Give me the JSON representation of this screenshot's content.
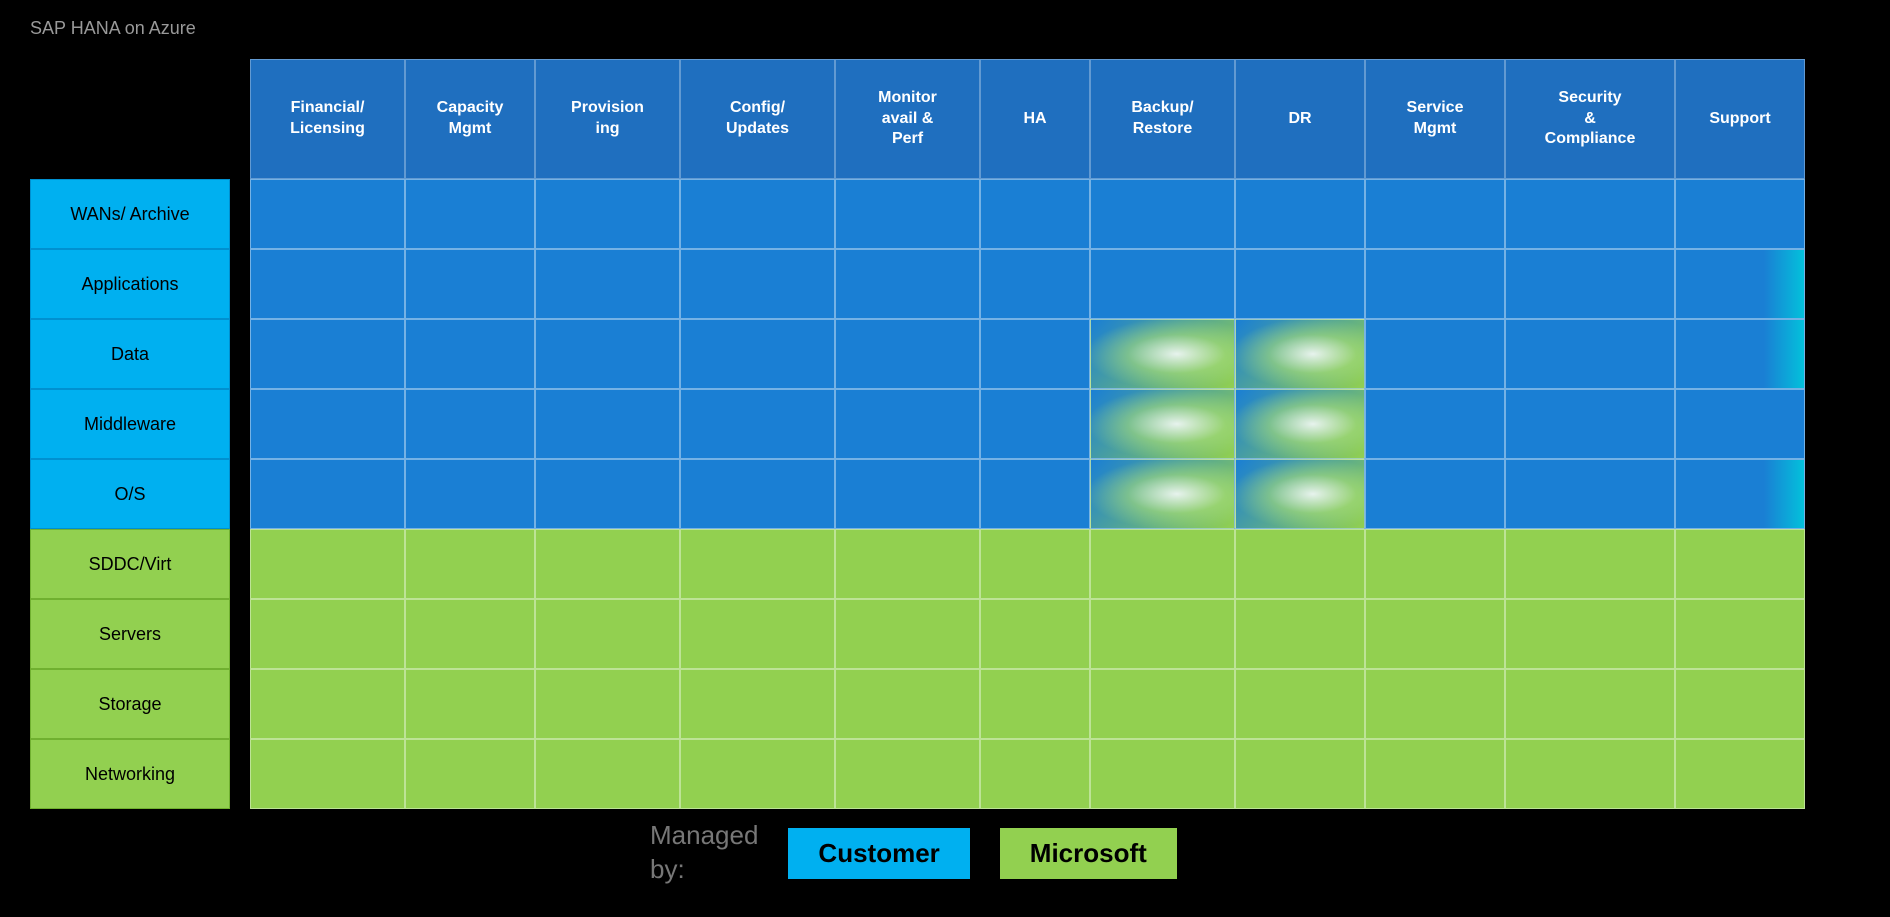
{
  "title": "SAP HANA on Azure",
  "columns": [
    {
      "label": "Financial/\nLicensing",
      "key": "col-0"
    },
    {
      "label": "Capacity\nMgmt",
      "key": "col-1"
    },
    {
      "label": "Provision\ning",
      "key": "col-2"
    },
    {
      "label": "Config/\nUpdates",
      "key": "col-3"
    },
    {
      "label": "Monitor\navail &\nPerf",
      "key": "col-4"
    },
    {
      "label": "HA",
      "key": "col-5"
    },
    {
      "label": "Backup/\nRestore",
      "key": "col-6"
    },
    {
      "label": "DR",
      "key": "col-7"
    },
    {
      "label": "Service\nMgmt",
      "key": "col-8"
    },
    {
      "label": "Security\n&\nCompliance",
      "key": "col-9"
    },
    {
      "label": "Support",
      "key": "col-10"
    }
  ],
  "rows": [
    {
      "label": "WANs/ Archive",
      "type": "blue"
    },
    {
      "label": "Applications",
      "type": "blue"
    },
    {
      "label": "Data",
      "type": "blue"
    },
    {
      "label": "Middleware",
      "type": "blue"
    },
    {
      "label": "O/S",
      "type": "blue"
    },
    {
      "label": "SDDC/Virt",
      "type": "green"
    },
    {
      "label": "Servers",
      "type": "green"
    },
    {
      "label": "Storage",
      "type": "green"
    },
    {
      "label": "Networking",
      "type": "green"
    }
  ],
  "legend": {
    "managed_by": "Managed\nby:",
    "customer_label": "Customer",
    "microsoft_label": "Microsoft"
  }
}
